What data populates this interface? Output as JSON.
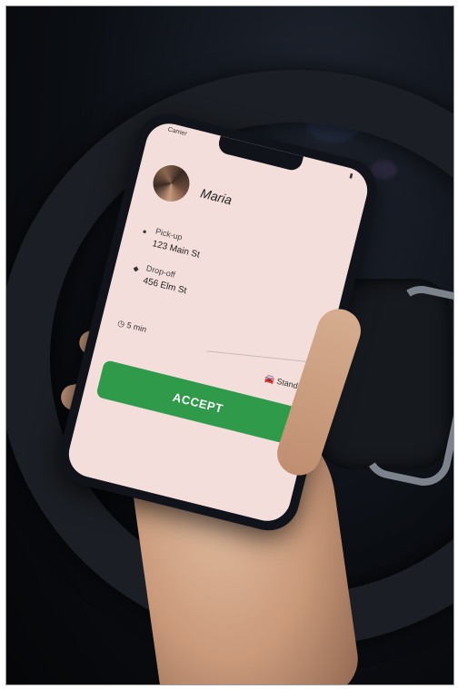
{
  "ride_request": {
    "carrier": "Carrier",
    "passenger_name": "Maria",
    "pickup_label": "Pick-up",
    "pickup_address": "123 Main St",
    "dropoff_label": "Drop-off",
    "dropoff_address": "456 Elm St",
    "eta": "5 min",
    "service_type": "Standard",
    "accept_label": "ACCEPT"
  },
  "icons": {
    "pickup": "location-dot-icon",
    "dropoff": "location-dot-icon",
    "eta": "clock-icon",
    "service": "car-icon"
  },
  "colors": {
    "accept_button": "#2f9a49",
    "screen_background": "#f4dedb"
  }
}
